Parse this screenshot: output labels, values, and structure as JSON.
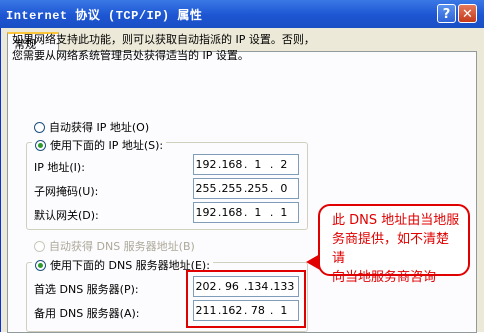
{
  "window": {
    "title": "Internet 协议 (TCP/IP) 属性",
    "help_glyph": "?",
    "close_glyph": "✕",
    "tab_general": "常规"
  },
  "intro": {
    "line1": "如果网络支持此功能，则可以获取自动指派的 IP 设置。否则，",
    "line2": "您需要从网络系统管理员处获得适当的 IP 设置。"
  },
  "ip": {
    "auto_label": "自动获得 IP 地址(O)",
    "manual_label": "使用下面的 IP 地址(S):",
    "selected": "manual",
    "address_label": "IP 地址(I):",
    "address": [
      "192",
      "168",
      "1",
      "2"
    ],
    "mask_label": "子网掩码(U):",
    "mask": [
      "255",
      "255",
      "255",
      "0"
    ],
    "gateway_label": "默认网关(D):",
    "gateway": [
      "192",
      "168",
      "1",
      "1"
    ]
  },
  "dns": {
    "auto_label": "自动获得 DNS 服务器地址(B)",
    "auto_disabled": true,
    "manual_label": "使用下面的 DNS 服务器地址(E):",
    "preferred_label": "首选 DNS 服务器(P):",
    "preferred": [
      "202",
      "96",
      "134",
      "133"
    ],
    "alternate_label": "备用 DNS 服务器(A):",
    "alternate": [
      "211",
      "162",
      "78",
      "1"
    ]
  },
  "annotation": {
    "line1": "此 DNS 地址由当地服",
    "line2": "务商提供，如不清楚请",
    "line3": "向当地服务商咨询",
    "color": "#e10000"
  },
  "colors": {
    "titlebar": "#1d55d2",
    "dialog_bg": "#ece9d8",
    "panel_bg": "#fcfcfe",
    "radio_dot": "#2b9a2b"
  }
}
